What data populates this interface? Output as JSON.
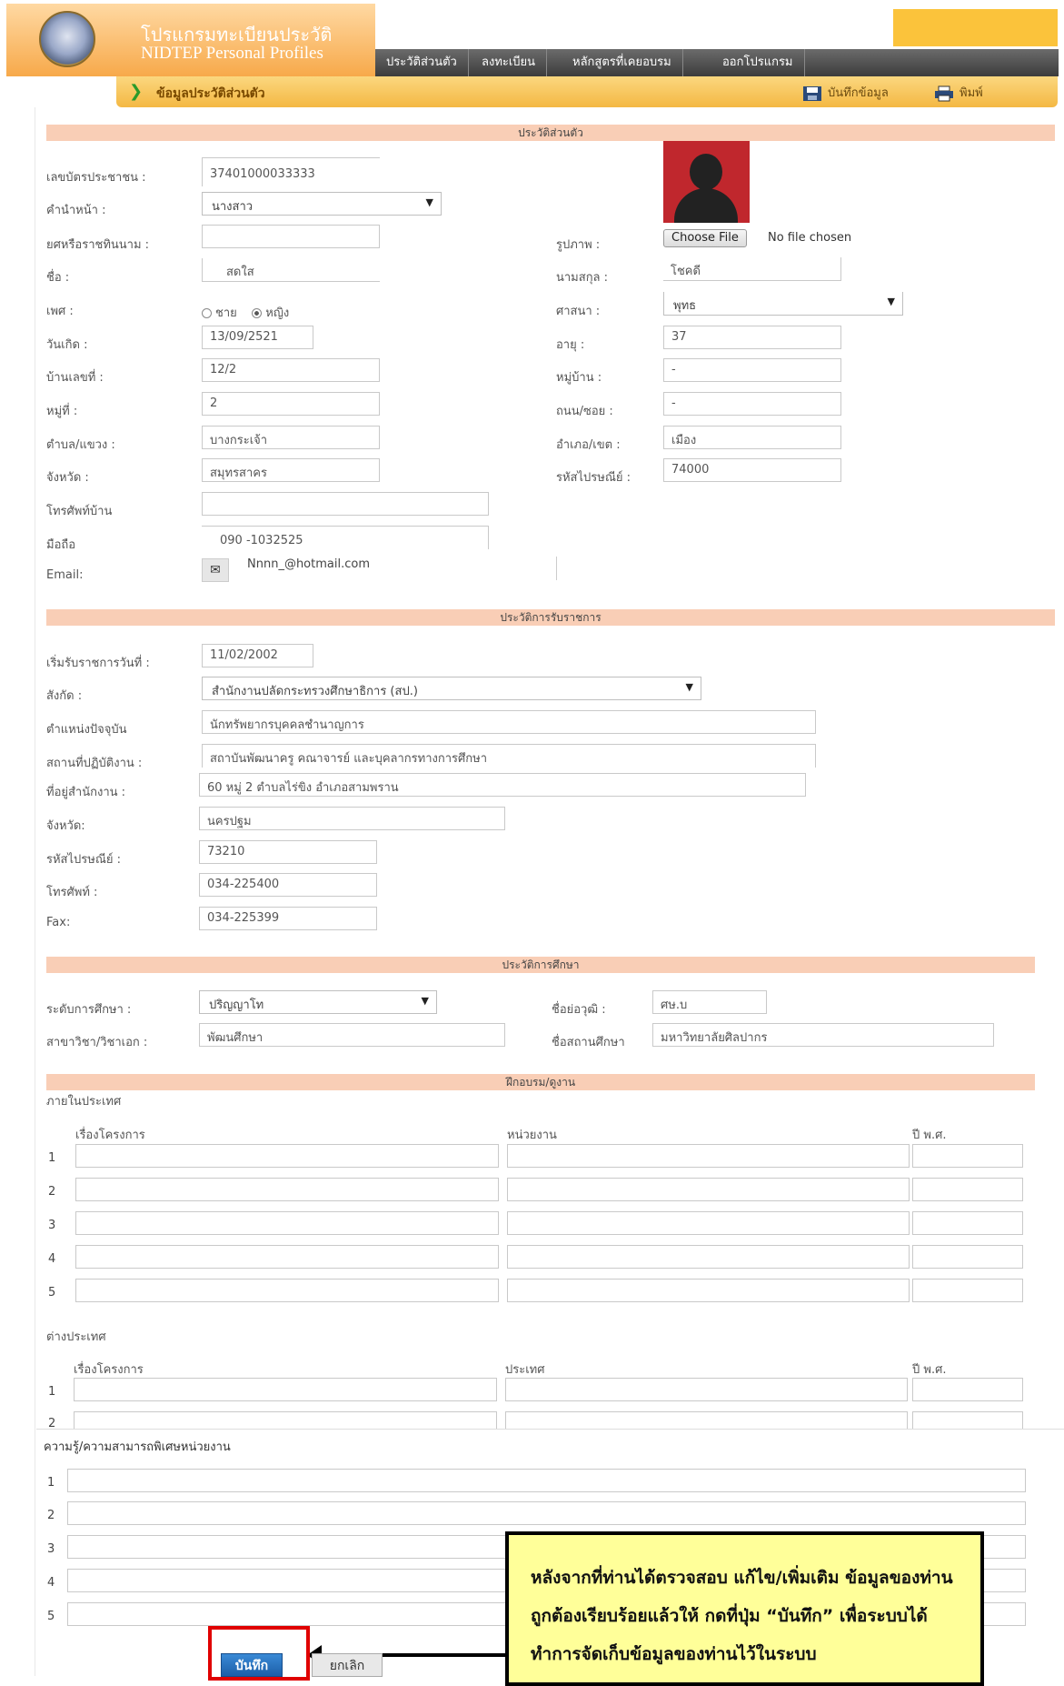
{
  "app": {
    "title_th": "โปรแกรมทะเบียนประวัติ",
    "title_en": "NIDTEP Personal Profiles"
  },
  "nav": {
    "tabs": [
      "ประวัติส่วนตัว",
      "ลงทะเบียน",
      "หลักสูตรที่เคยอบรม",
      "ออกโปรแกรม"
    ]
  },
  "subbar": {
    "title": "ข้อมูลประวัติส่วนตัว",
    "save_label": "บันทึกข้อมูล",
    "print_label": "พิมพ์"
  },
  "personal": {
    "section_title": "ประวัติส่วนตัว",
    "labels": {
      "id_card": "เลขบัตรประชาชน :",
      "prefix": "คำนำหน้า :",
      "rank": "ยศหรือราชทินนาม :",
      "first_name": "ชื่อ :",
      "gender": "เพศ :",
      "birthdate": "วันเกิด :",
      "house_no": "บ้านเลขที่ :",
      "moo": "หมู่ที่ :",
      "subdistrict": "ตำบล/แขวง :",
      "province": "จังหวัด :",
      "home_phone": "โทรศัพท์บ้าน",
      "mobile": "มือถือ",
      "email": "Email:",
      "photo": "รูปภาพ :",
      "last_name": "นามสกุล :",
      "religion": "ศาสนา :",
      "age": "อายุ :",
      "village": "หมู่บ้าน :",
      "road": "ถนน/ซอย :",
      "district": "อำเภอ/เขต :",
      "postcode": "รหัสไปรษณีย์ :"
    },
    "values": {
      "id_card": "37401000033333",
      "prefix": "นางสาว",
      "rank": "",
      "first_name": "สดใส",
      "gender_male": "ชาย",
      "gender_female": "หญิง",
      "gender_selected": "หญิง",
      "birthdate": "13/09/2521",
      "house_no": "12/2",
      "moo": "2",
      "subdistrict": "บางกระเจ้า",
      "province": "สมุทรสาคร",
      "home_phone": "",
      "mobile": "090 -1032525",
      "email": "Nnnn_@hotmail.com",
      "choose_file": "Choose File",
      "no_file": "No file chosen",
      "last_name": "โชคดี",
      "religion": "พุทธ",
      "age": "37",
      "village": "-",
      "road": "-",
      "district": "เมือง",
      "postcode": "74000"
    }
  },
  "service": {
    "section_title": "ประวัติการรับราชการ",
    "labels": {
      "start_date": "เริ่มรับราชการวันที่ :",
      "affiliation": "สังกัด :",
      "position": "ตำแหน่งปัจจุบัน",
      "workplace": "สถานที่ปฏิบัติงาน :",
      "office_address": "ที่อยู่สำนักงาน :",
      "province": "จังหวัด:",
      "postcode": "รหัสไปรษณีย์ :",
      "phone": "โทรศัพท์ :",
      "fax": "Fax:"
    },
    "values": {
      "start_date": "11/02/2002",
      "affiliation": "สำนักงานปลัดกระทรวงศึกษาธิการ (สป.)",
      "position": "นักทรัพยากรบุคคลชำนาญการ",
      "workplace": "สถาบันพัฒนาครู คณาจารย์ และบุคลากรทางการศึกษา",
      "office_address": "60 หมู่ 2 ตำบลไร่ขิง อำเภอสามพราน",
      "province": "นครปฐม",
      "postcode": "73210",
      "phone": "034-225400",
      "fax": "034-225399"
    }
  },
  "education": {
    "section_title": "ประวัติการศึกษา",
    "labels": {
      "level": "ระดับการศึกษา :",
      "major": "สาขาวิชา/วิชาเอก :",
      "degree_abbr": "ชื่อย่อวุฒิ :",
      "institution": "ชื่อสถานศึกษา"
    },
    "values": {
      "level": "ปริญญาโท",
      "major": "พัฒนศึกษา",
      "degree_abbr": "ศษ.บ",
      "institution": "มหาวิทยาลัยศิลปากร"
    }
  },
  "training": {
    "section_title": "ฝึกอบรม/ดูงาน",
    "domestic_title": "ภายในประเทศ",
    "domestic_headers": [
      "เรื่องโครงการ",
      "หน่วยงาน",
      "ปี พ.ศ."
    ],
    "foreign_title": "ต่างประเทศ",
    "foreign_headers": [
      "เรื่องโครงการ",
      "ประเทศ",
      "ปี พ.ศ."
    ],
    "row_numbers": [
      "1",
      "2",
      "3",
      "4",
      "5"
    ]
  },
  "skills": {
    "section_title": "ความรู้/ความสามารถพิเศษหน่วยงาน",
    "row_numbers": [
      "1",
      "2",
      "3",
      "4",
      "5"
    ]
  },
  "actions": {
    "save": "บันทึก",
    "cancel": "ยกเลิก"
  },
  "callout": {
    "text": "หลังจากที่ท่านได้ตรวจสอบ แก้ไข/เพิ่มเติม ข้อมูลของท่านถูกต้องเรียบร้อยแล้วให้ กดที่ปุ่ม “บันทึก” เพื่อระบบได้ทำการจัดเก็บข้อมูลของท่านไว้ในระบบ"
  },
  "colors": {
    "header_orange": "#f7a94a",
    "subbar_yellow": "#f4b843",
    "section_peach": "#f9ceb6",
    "callout_yellow": "#ffff99",
    "highlight_red": "#e00000"
  }
}
